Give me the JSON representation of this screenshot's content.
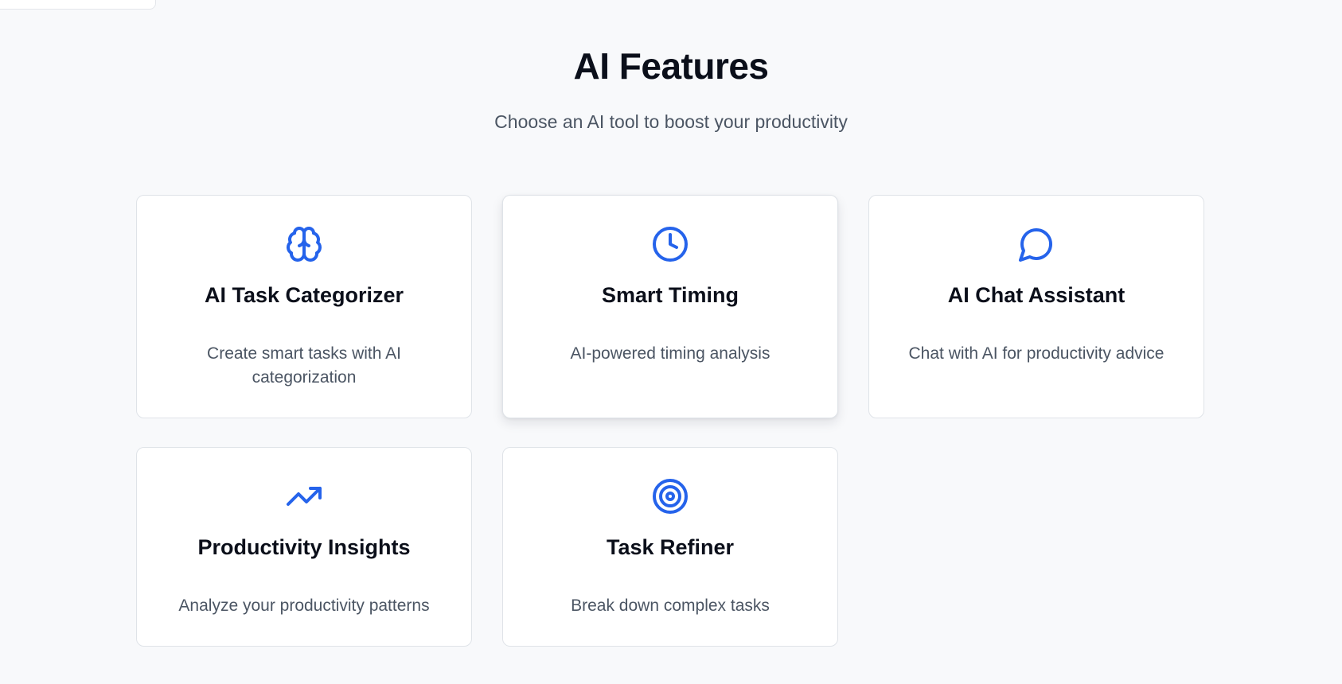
{
  "header": {
    "title": "AI Features",
    "subtitle": "Choose an AI tool to boost your productivity"
  },
  "accent_color": "#2563eb",
  "features": [
    {
      "icon": "brain-icon",
      "title": "AI Task Categorizer",
      "description": "Create smart tasks with AI categorization"
    },
    {
      "icon": "clock-icon",
      "title": "Smart Timing",
      "description": "AI-powered timing analysis"
    },
    {
      "icon": "chat-bubble-icon",
      "title": "AI Chat Assistant",
      "description": "Chat with AI for productivity advice"
    },
    {
      "icon": "trending-up-icon",
      "title": "Productivity Insights",
      "description": "Analyze your productivity patterns"
    },
    {
      "icon": "target-icon",
      "title": "Task Refiner",
      "description": "Break down complex tasks"
    }
  ]
}
